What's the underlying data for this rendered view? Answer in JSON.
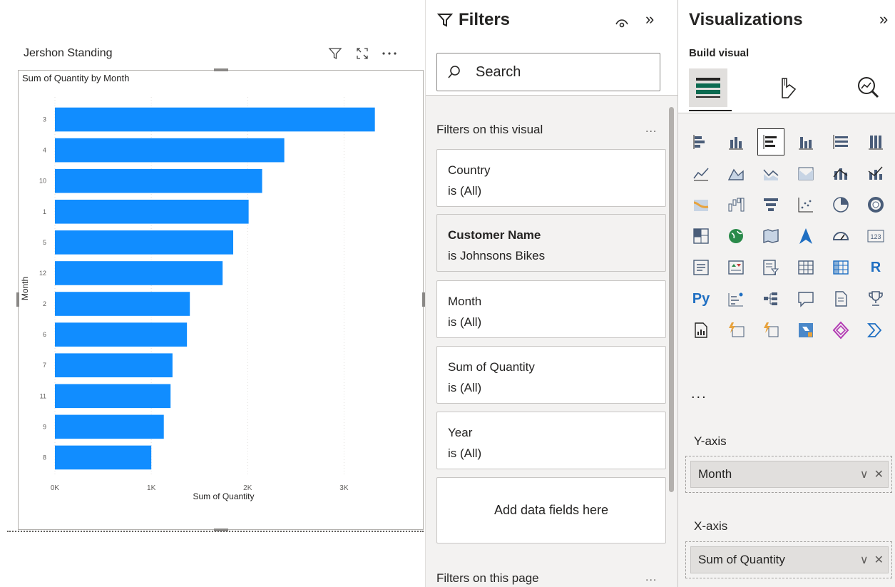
{
  "visual": {
    "header_title": "Jershon Standing",
    "chart_title": "Sum of Quantity by Month"
  },
  "chart_data": {
    "type": "bar",
    "orientation": "horizontal",
    "title": "Sum of Quantity by Month",
    "xlabel": "Sum of Quantity",
    "ylabel": "Month",
    "categories": [
      "3",
      "4",
      "10",
      "1",
      "5",
      "12",
      "2",
      "6",
      "7",
      "11",
      "9",
      "8"
    ],
    "values": [
      3320,
      2380,
      2150,
      2010,
      1850,
      1740,
      1400,
      1370,
      1220,
      1200,
      1130,
      1000
    ],
    "xlim": [
      0,
      3500
    ],
    "xticks": [
      0,
      1000,
      2000,
      3000
    ],
    "xtick_labels": [
      "0K",
      "1K",
      "2K",
      "3K"
    ],
    "bar_color": "#118DFF",
    "grid": "vertical dotted"
  },
  "filters": {
    "title": "Filters",
    "search_placeholder": "Search",
    "visual_section": "Filters on this visual",
    "page_section": "Filters on this page",
    "more": "...",
    "cards": [
      {
        "name": "Country",
        "state": "is (All)"
      },
      {
        "name": "Customer Name",
        "state": "is Johnsons Bikes"
      },
      {
        "name": "Month",
        "state": "is (All)"
      },
      {
        "name": "Sum of Quantity",
        "state": "is (All)"
      },
      {
        "name": "Year",
        "state": "is (All)"
      }
    ],
    "add_fields": "Add data fields here"
  },
  "viz": {
    "title": "Visualizations",
    "build_label": "Build visual",
    "more": "...",
    "yaxis_label": "Y-axis",
    "yaxis_field": "Month",
    "xaxis_label": "X-axis",
    "xaxis_field": "Sum of Quantity",
    "icon_R": "R",
    "icon_Py": "Py"
  },
  "colors": {
    "accent": "#118DFF",
    "pane_bg": "#f3f2f1"
  }
}
